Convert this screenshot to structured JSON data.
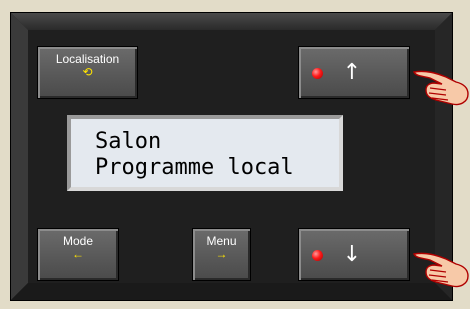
{
  "buttons": {
    "localisation": {
      "label": "Localisation",
      "glyph": "⟲"
    },
    "mode": {
      "label": "Mode",
      "glyph": "←"
    },
    "menu": {
      "label": "Menu",
      "glyph": "→"
    },
    "up": {
      "glyph": "↑"
    },
    "down": {
      "glyph": "↓"
    }
  },
  "lcd": {
    "line1": "Salon",
    "line2": "Programme local"
  },
  "colors": {
    "background": "#e2dcc8",
    "panel": "#1f1f1f",
    "button": "#5a5a5a",
    "button_glyph": "#ffe400",
    "led": "#ff1a1a",
    "lcd_background": "#e4e9ef"
  },
  "icons": {
    "localisation": "rotate-icon",
    "up": "arrow-up-icon",
    "down": "arrow-down-icon",
    "led": "red-led-icon",
    "hand": "pointing-hand-icon"
  }
}
